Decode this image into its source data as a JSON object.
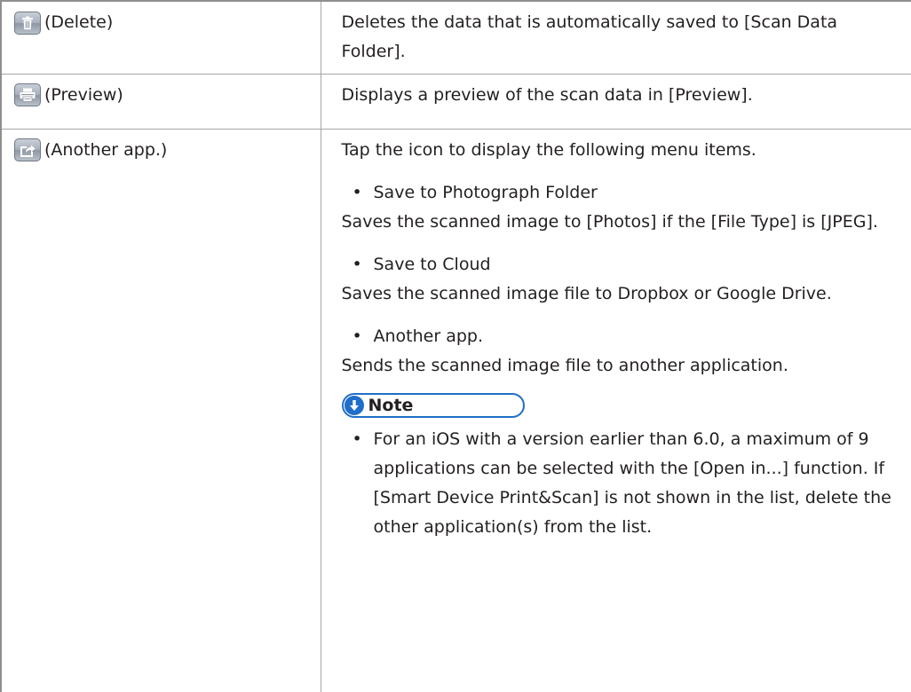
{
  "rows": [
    {
      "icon": "trash-icon",
      "name": "(Delete)",
      "description": "Deletes the data that is automatically saved to [Scan Data Folder]."
    },
    {
      "icon": "printer-icon",
      "name": "(Preview)",
      "description": "Displays a preview of the scan data in [Preview]."
    },
    {
      "icon": "share-icon",
      "name": "(Another app.)",
      "description": "Tap the icon to display the following menu items.",
      "menu_items": [
        {
          "title": "Save to Photograph Folder",
          "detail": "Saves the scanned image to [Photos] if the [File Type] is [JPEG]."
        },
        {
          "title": "Save to Cloud",
          "detail": "Saves the scanned image file to Dropbox or Google Drive."
        },
        {
          "title": "Another app.",
          "detail": "Sends the scanned image file to another application."
        }
      ],
      "note": {
        "label": "Note",
        "icon": "down-arrow-circle-icon",
        "items": [
          "For an iOS with a version earlier than 6.0, a maximum of 9 applications can be selected with the [Open in...] function. If [Smart Device Print&Scan] is not shown in the list, delete the other application(s) from the list."
        ]
      }
    }
  ],
  "bullet_char": "•",
  "colors": {
    "border": "#a6a6a6",
    "note_accent": "#1f6ec9",
    "text": "#231f20"
  }
}
